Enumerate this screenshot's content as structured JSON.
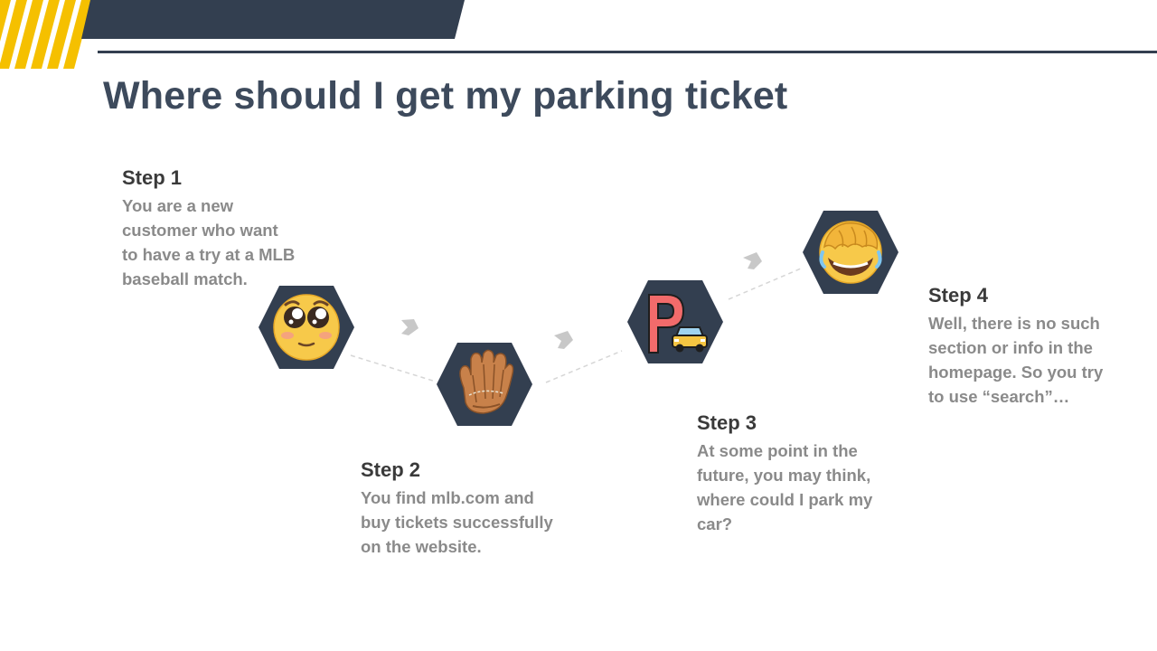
{
  "header": {
    "accent_color": "#f5c000",
    "bar_color": "#333f50"
  },
  "title": "Where should I get my parking ticket",
  "steps": [
    {
      "heading": "Step 1",
      "lines": [
        "You are a new",
        "customer who want",
        "to have a try at a MLB",
        "baseball match."
      ],
      "icon": "pleading-face-icon"
    },
    {
      "heading": "Step 2",
      "lines": [
        "You find mlb.com and",
        "buy tickets successfully",
        "on the website."
      ],
      "icon": "baseball-glove-icon"
    },
    {
      "heading": "Step 3",
      "lines": [
        "At some point in the",
        "future, you may think,",
        "where could I park my",
        "car?"
      ],
      "icon": "parking-car-icon"
    },
    {
      "heading": "Step 4",
      "lines": [
        "Well, there is no such",
        "section or info in the",
        "homepage. So you try",
        "to use “search”…"
      ],
      "icon": "facepalm-laugh-icon"
    }
  ],
  "hex_color": "#333f50",
  "arrow_color": "#c8c8c8"
}
